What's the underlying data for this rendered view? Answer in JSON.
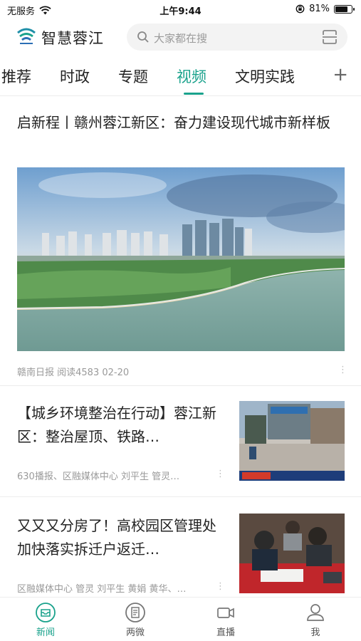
{
  "status_bar": {
    "carrier": "无服务",
    "time": "上午9:44",
    "battery": "81%",
    "battery_level": 0.81
  },
  "header": {
    "app_name": "智慧蓉江",
    "search_placeholder": "大家都在搜"
  },
  "tabs": [
    {
      "label": "推荐",
      "active": false
    },
    {
      "label": "时政",
      "active": false
    },
    {
      "label": "专题",
      "active": false
    },
    {
      "label": "视频",
      "active": true
    },
    {
      "label": "文明实践",
      "active": false
    }
  ],
  "tab_plus": "+",
  "feature": {
    "title": "启新程丨赣州蓉江新区：奋力建设现代城市新样板",
    "meta": "赣南日报  阅读4583  02-20"
  },
  "articles": [
    {
      "title": "【城乡环境整治在行动】蓉江新区：整治屋顶、铁路…",
      "meta": "630播报、区融媒体中心 刘平生 管灵…"
    },
    {
      "title": "又又又分房了！高校园区管理处加快落实拆迁户返迁…",
      "meta": "区融媒体中心 管灵 刘平生 黄娟 黄华、…"
    }
  ],
  "bottom_nav": [
    {
      "label": "新闻",
      "icon": "news-icon",
      "active": true
    },
    {
      "label": "两微",
      "icon": "document-icon",
      "active": false
    },
    {
      "label": "直播",
      "icon": "video-camera-icon",
      "active": false
    },
    {
      "label": "我",
      "icon": "user-icon",
      "active": false
    }
  ],
  "colors": {
    "accent": "#1aa28c",
    "text": "#222222",
    "meta": "#9a9a9a"
  }
}
